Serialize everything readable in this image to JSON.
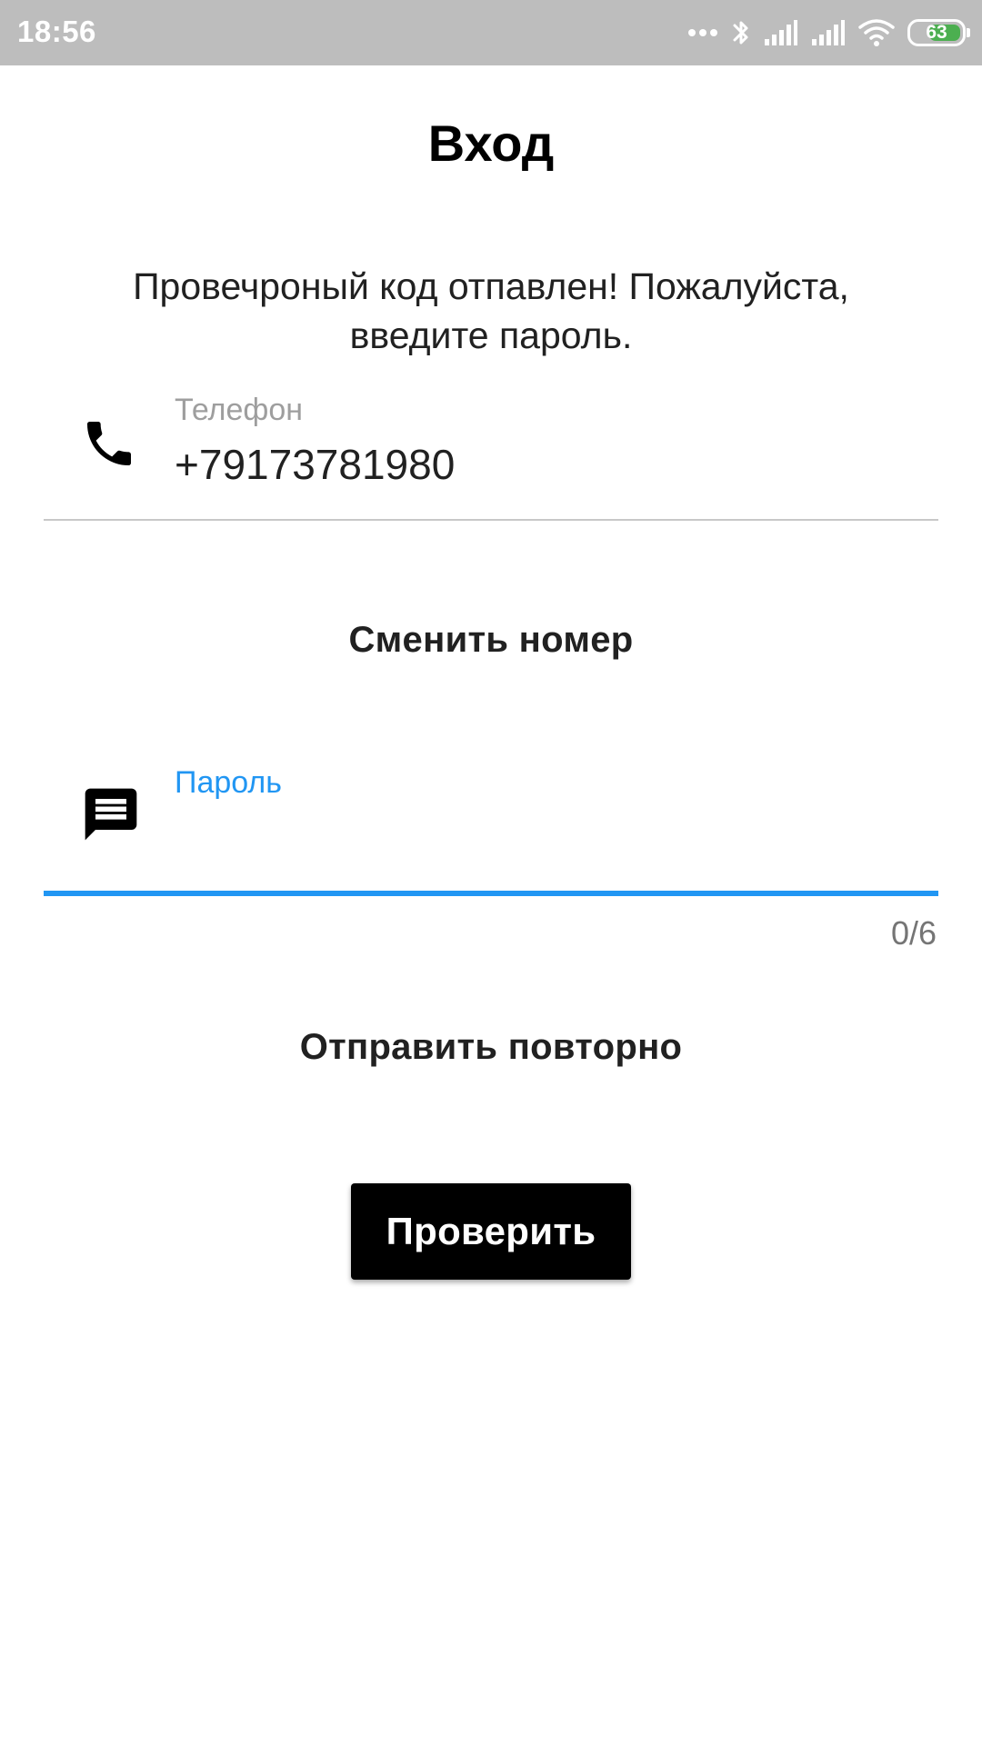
{
  "status_bar": {
    "time": "18:56",
    "battery_level": "63",
    "battery_color": "#4caf50",
    "icons": [
      "more-dots-icon",
      "bluetooth-icon",
      "signal-icon",
      "signal-icon",
      "wifi-icon",
      "battery-icon"
    ]
  },
  "page": {
    "title": "Вход",
    "message": "Провечроный код отпавлен! Пожалуйста, введите пароль."
  },
  "phone_field": {
    "icon": "phone-icon",
    "label": "Телефон",
    "value": "+79173781980"
  },
  "change_number_label": "Сменить номер",
  "password_field": {
    "icon": "message-icon",
    "label": "Пароль",
    "value": "",
    "counter": "0/6",
    "accent_color": "#2196f3"
  },
  "resend_label": "Отправить повторно",
  "verify_button_label": "Проверить"
}
